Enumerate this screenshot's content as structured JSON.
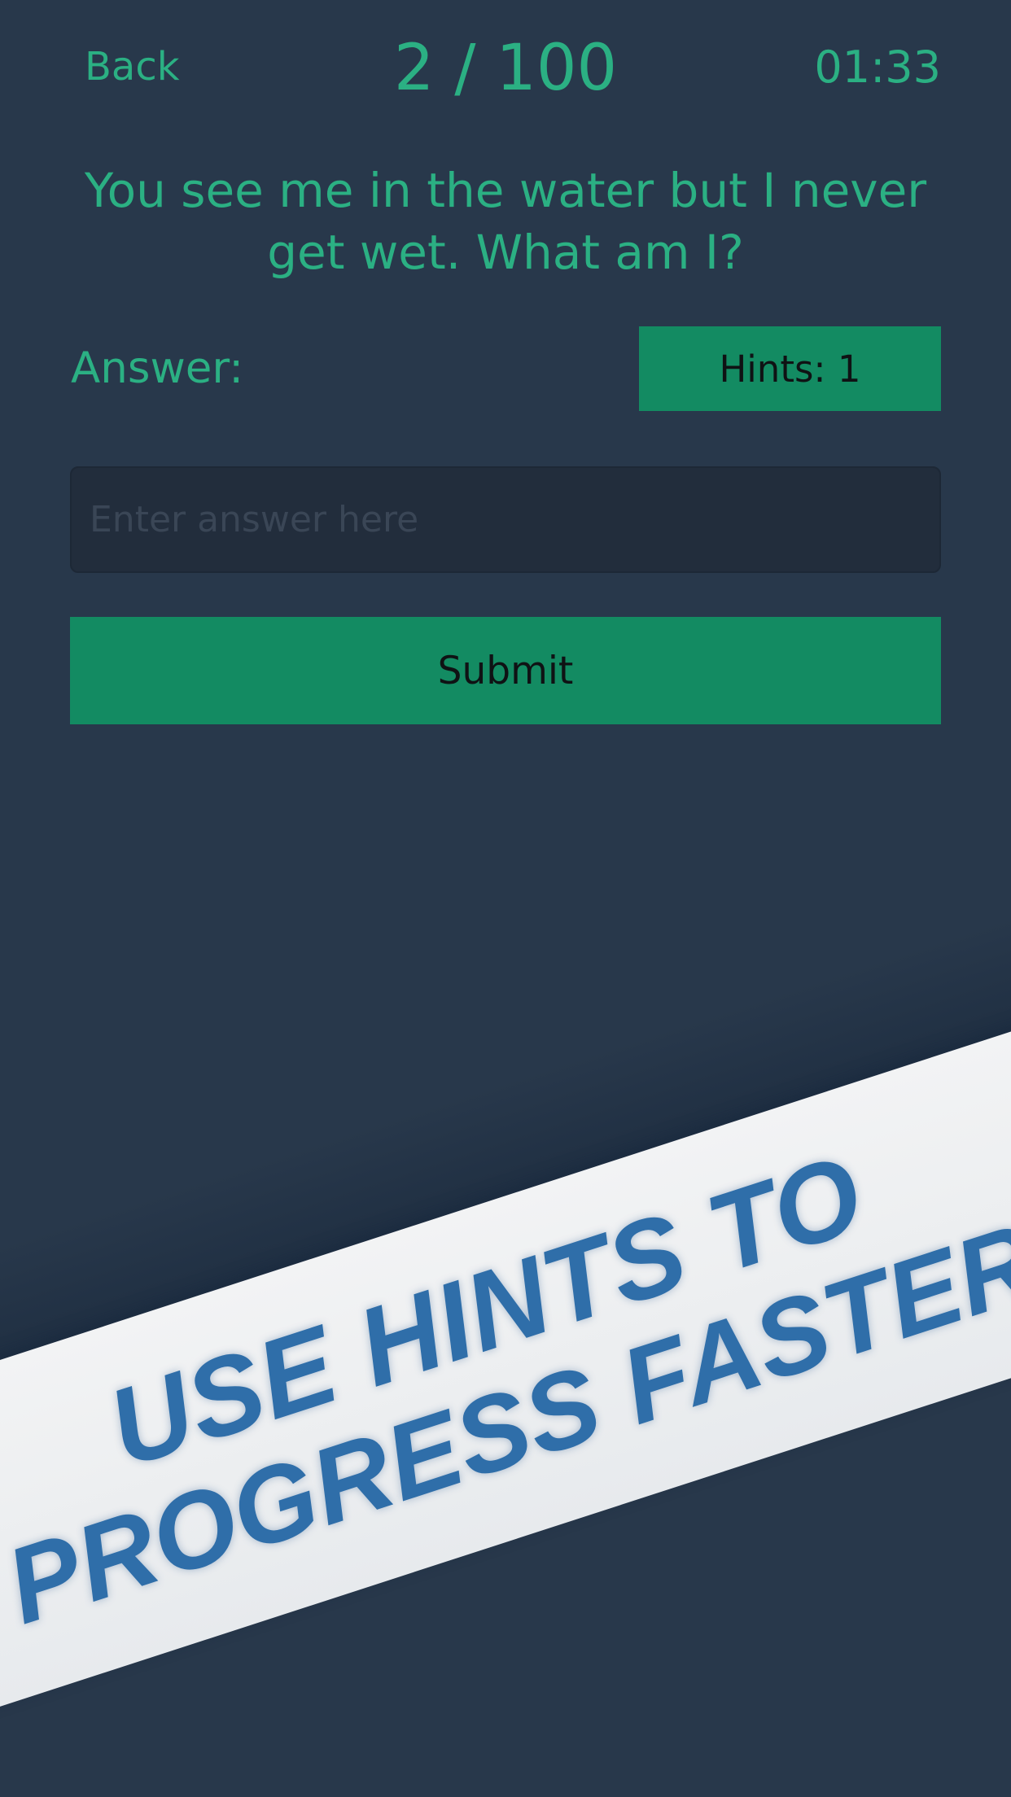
{
  "header": {
    "back_label": "Back",
    "progress": "2 / 100",
    "timer": "01:33"
  },
  "question": {
    "text": "You see me in the water but I never get wet. What am I?"
  },
  "answer": {
    "label": "Answer:",
    "hints_label": "Hints: 1",
    "placeholder": "Enter answer here",
    "submit_label": "Submit"
  },
  "promo": {
    "line1": "USE HINTS TO",
    "line2": "PROGRESS FASTER"
  },
  "colors": {
    "background": "#28384b",
    "accent_text": "#2bb083",
    "button_fill": "#138b62",
    "input_fill": "#222d3c",
    "banner_fill": "#eef0f2",
    "banner_text": "#2f6ea9"
  }
}
